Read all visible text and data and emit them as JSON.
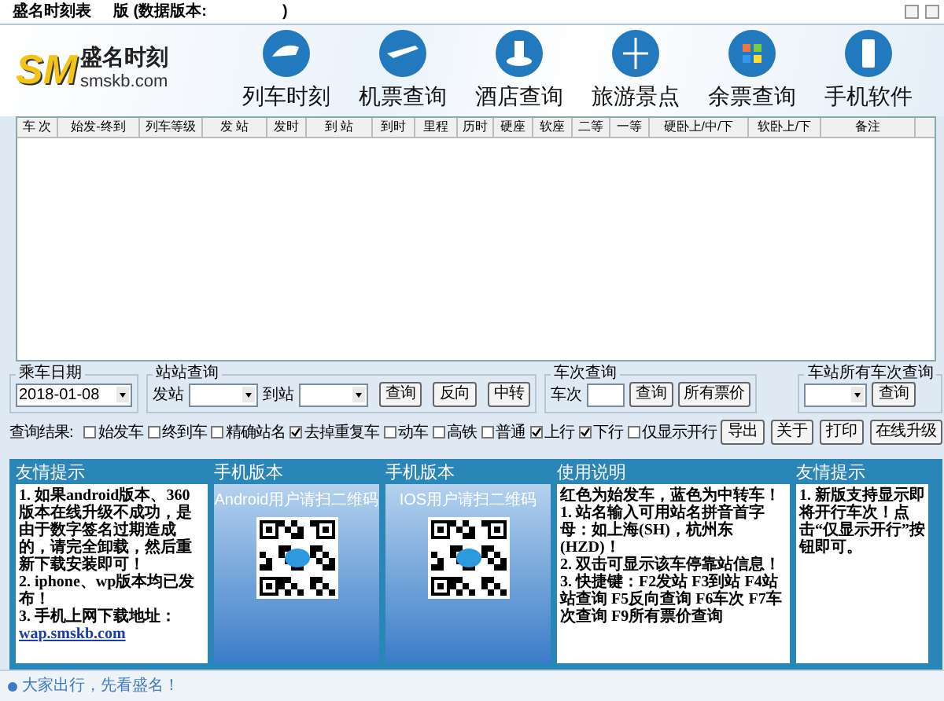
{
  "window": {
    "title": "盛名时刻表",
    "version_label": "版 (数据版本:",
    "version_close": ")"
  },
  "logo": {
    "mark": "SM",
    "name": "盛名时刻",
    "site": "smskb.com"
  },
  "nav": [
    {
      "label": "列车时刻"
    },
    {
      "label": "机票查询"
    },
    {
      "label": "酒店查询"
    },
    {
      "label": "旅游景点"
    },
    {
      "label": "余票查询"
    },
    {
      "label": "手机软件"
    }
  ],
  "table": {
    "columns": [
      "车 次",
      "始发-终到",
      "列车等级",
      "发 站",
      "发时",
      "到 站",
      "到时",
      "里程",
      "历时",
      "硬座",
      "软座",
      "二等",
      "一等",
      "硬卧上/中/下",
      "软卧上/下",
      "备注"
    ]
  },
  "date_group": {
    "legend": "乘车日期",
    "value": "2018-01-08"
  },
  "station_group": {
    "legend": "站站查询",
    "from_label": "发站",
    "to_label": "到站",
    "buttons": [
      "查询",
      "反向",
      "中转"
    ]
  },
  "train_group": {
    "legend": "车次查询",
    "label": "车次",
    "buttons": [
      "查询",
      "所有票价"
    ]
  },
  "all_group": {
    "legend": "车站所有车次查询",
    "buttons": [
      "查询"
    ]
  },
  "filters": {
    "label": "查询结果:",
    "options": [
      {
        "label": "始发车",
        "checked": false
      },
      {
        "label": "终到车",
        "checked": false
      },
      {
        "label": "精确站名",
        "checked": false
      },
      {
        "label": "去掉重复车",
        "checked": true
      },
      {
        "label": "动车",
        "checked": false
      },
      {
        "label": "高铁",
        "checked": false
      },
      {
        "label": "普通",
        "checked": false
      },
      {
        "label": "上行",
        "checked": true
      },
      {
        "label": "下行",
        "checked": true
      },
      {
        "label": "仅显示开行",
        "checked": false
      }
    ],
    "buttons": [
      "导出",
      "关于",
      "打印",
      "在线升级"
    ]
  },
  "panels": [
    {
      "kind": "text",
      "title": "友情提示",
      "lines": [
        {
          "kind": "text",
          "text": "1. 如果android版本、360版本在线升级不成功，是由于数字签名过期造成的，请完全卸载，然后重新下载安装即可！"
        },
        {
          "kind": "text",
          "text": "2. iphone、wp版本均已发布！"
        },
        {
          "kind": "text",
          "text": "3. 手机上网下载地址："
        },
        {
          "kind": "link",
          "text": "wap.smskb.com"
        }
      ]
    },
    {
      "kind": "qr",
      "title": "手机版本",
      "caption": "Android用户请扫二维码"
    },
    {
      "kind": "qr",
      "title": "手机版本",
      "caption": "IOS用户请扫二维码"
    },
    {
      "kind": "text",
      "title": "使用说明",
      "lines": [
        {
          "kind": "text",
          "text": "红色为始发车，蓝色为中转车！"
        },
        {
          "kind": "text",
          "text": "1. 站名输入可用站名拼音首字母：如上海(SH)，杭州东(HZD)！"
        },
        {
          "kind": "text",
          "text": "2. 双击可显示该车停靠站信息！"
        },
        {
          "kind": "text",
          "text": "3. 快捷键：F2发站 F3到站 F4站站查询 F5反向查询 F6车次 F7车次查询 F9所有票价查询"
        }
      ]
    },
    {
      "kind": "text",
      "title": "友情提示",
      "lines": [
        {
          "kind": "text",
          "text": "1. 新版支持显示即将开行车次！点击“仅显示开行”按钮即可。"
        }
      ]
    }
  ],
  "status_bar": {
    "text": "大家出行，先看盛名！"
  }
}
